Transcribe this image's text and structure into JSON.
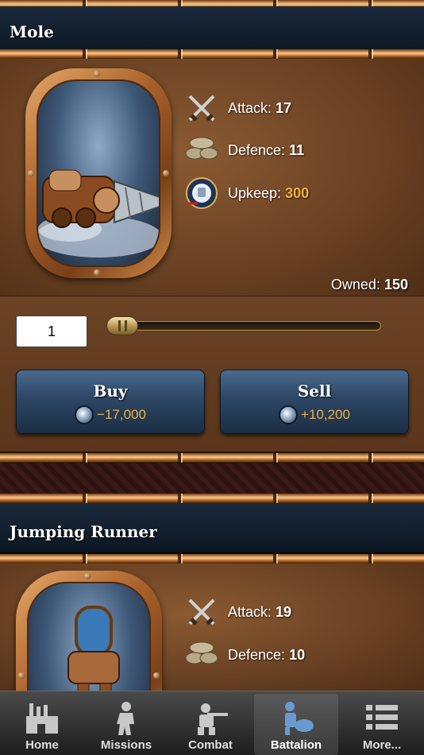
{
  "units": [
    {
      "name": "Mole",
      "attack_label": "Attack:",
      "attack": "17",
      "defence_label": "Defence:",
      "defence": "11",
      "upkeep_label": "Upkeep:",
      "upkeep": "300",
      "owned_label": "Owned:",
      "owned": "150",
      "quantity": "1",
      "quantity_slider_fraction": 0,
      "buy": {
        "label": "Buy",
        "price": "−17,000"
      },
      "sell": {
        "label": "Sell",
        "price": "+10,200"
      }
    },
    {
      "name": "Jumping Runner",
      "attack_label": "Attack:",
      "attack": "19",
      "defence_label": "Defence:",
      "defence": "10"
    }
  ],
  "tabs": [
    {
      "label": "Home",
      "icon": "factory-icon",
      "active": false
    },
    {
      "label": "Missions",
      "icon": "soldier-icon",
      "active": false
    },
    {
      "label": "Combat",
      "icon": "gunner-icon",
      "active": false
    },
    {
      "label": "Battalion",
      "icon": "battalion-icon",
      "active": true
    },
    {
      "label": "More...",
      "icon": "list-icon",
      "active": false
    }
  ],
  "colors": {
    "header_bg": "#12202e",
    "panel_bg": "#6b4224",
    "button_bg": "#2c4664",
    "price_gold": "#f0b040",
    "upkeep_gold": "#f0b040",
    "tabbar_bg": "#2a2a2a"
  }
}
